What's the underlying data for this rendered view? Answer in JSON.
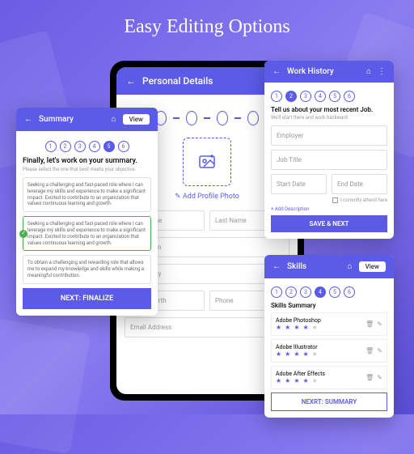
{
  "title": "Easy Editing Options",
  "phone": {
    "header": "Personal Details",
    "addPhoto": "Add Profile Photo",
    "fields": {
      "firstName": "First Name",
      "lastName": "Last Name",
      "profession": "Profession",
      "nationality": "Nationality",
      "dob": "Date of Birth",
      "phone": "Phone",
      "email": "Email Address"
    }
  },
  "summary": {
    "header": "Summary",
    "view": "View",
    "headline": "Finally, let's work on your summary.",
    "sub": "Please select the one that best meets your objective.",
    "opt1": "Seeking a challenging and fast-paced role where I can leverage my skills and experience to make a significant impact. Excited to contribute to an organization that values continuous learning and growth.",
    "opt2": "Seeking a challenging and fast-paced role where I can leverage my skills and experience to make a significant impact. Excited to contribute to an organization that values continuous learning and growth.",
    "opt3": "To obtain a challenging and rewarding role that allows me to expand my knowledge and skills while making a meaningful contribution.",
    "button": "NEXT: FINALIZE"
  },
  "work": {
    "header": "Work History",
    "headline": "Tell us about your most recent Job.",
    "sub": "We'll start there and work backward",
    "employer": "Employer",
    "jobTitle": "Job Title",
    "startDate": "Start Date",
    "endDate": "End Date",
    "currently": "I currently attend here",
    "addDesc": "+ Add Description",
    "button": "SAVE & NEXT"
  },
  "skills": {
    "header": "Skills",
    "view": "View",
    "summary": "Skills Summary",
    "items": [
      {
        "name": "Adobe Photoshop",
        "rating": 4
      },
      {
        "name": "Adobe Illustrator",
        "rating": 4
      },
      {
        "name": "Adobe After Effects",
        "rating": 4
      }
    ],
    "button": "NEXRT: SUMMARY"
  }
}
